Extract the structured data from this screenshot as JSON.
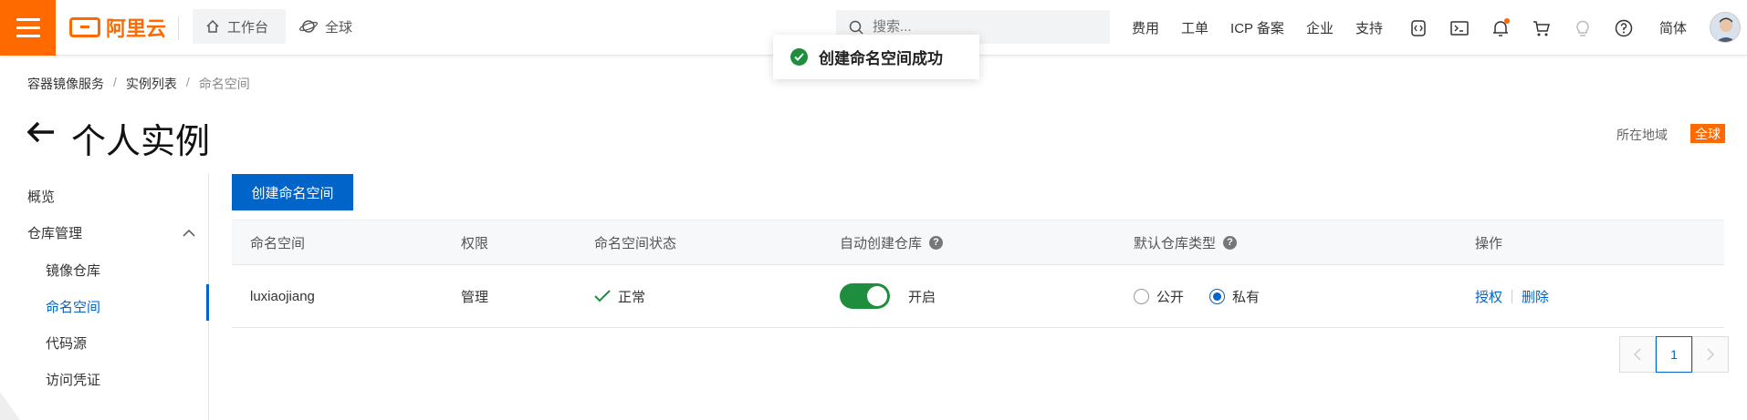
{
  "header": {
    "logo_text": "阿里云",
    "workbench": "工作台",
    "global": "全球",
    "search_placeholder": "搜索...",
    "links": [
      "费用",
      "工单",
      "ICP 备案",
      "企业",
      "支持"
    ],
    "lang": "简体",
    "accent_color": "#ff6a00",
    "icons": [
      "code-icon",
      "terminal-icon",
      "bell-icon",
      "cart-icon",
      "lightbulb-icon",
      "help-icon"
    ]
  },
  "toast": {
    "message": "创建命名空间成功"
  },
  "breadcrumb": [
    "容器镜像服务",
    "实例列表",
    "命名空间"
  ],
  "page": {
    "title": "个人实例",
    "region_label": "所在地域",
    "region_value": "全球"
  },
  "sidebar": {
    "overview": "概览",
    "repo_mgmt": "仓库管理",
    "items": [
      "镜像仓库",
      "命名空间",
      "代码源",
      "访问凭证"
    ]
  },
  "main": {
    "create_button": "创建命名空间",
    "columns": [
      "命名空间",
      "权限",
      "命名空间状态",
      "自动创建仓库",
      "默认仓库类型",
      "操作"
    ],
    "row": {
      "namespace": "luxiaojiang",
      "permission": "管理",
      "status": "正常",
      "auto_create": "开启",
      "type_public": "公开",
      "type_private": "私有",
      "action_auth": "授权",
      "action_delete": "删除"
    },
    "page_number": "1"
  },
  "colors": {
    "primary": "#0064c8",
    "success": "#1e8e3e"
  }
}
